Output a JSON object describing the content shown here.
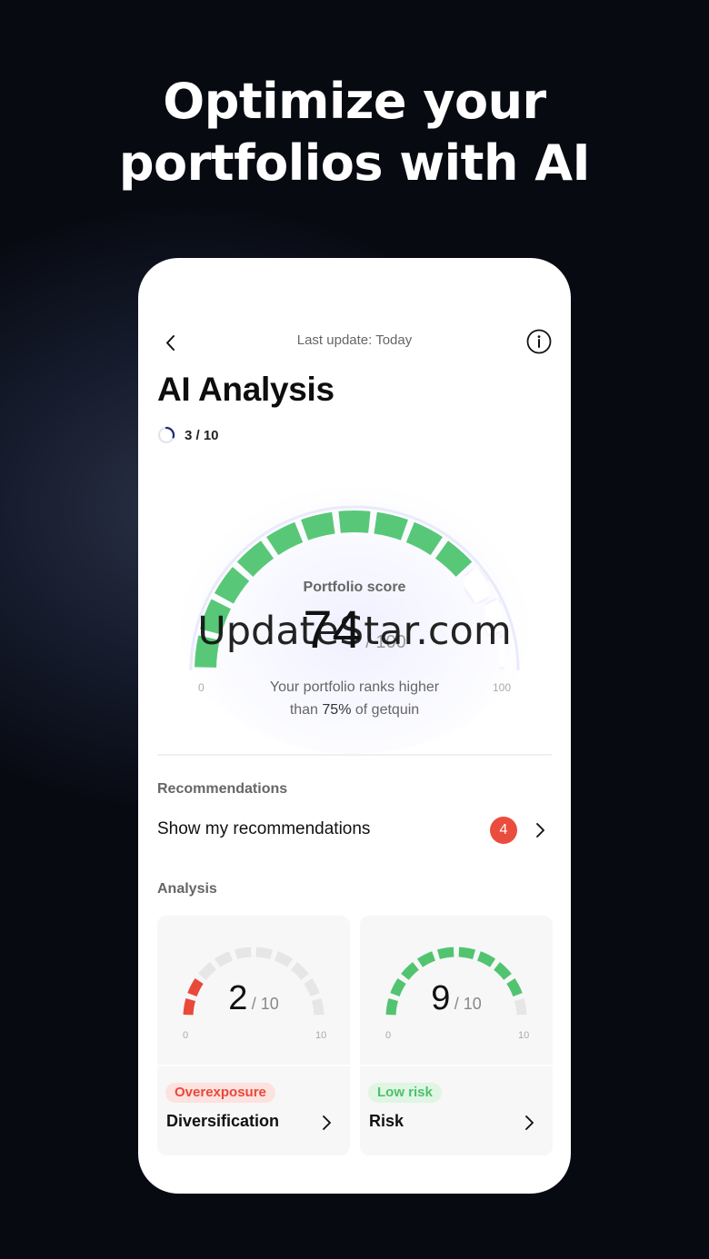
{
  "headline": {
    "line1": "Optimize your",
    "line2": "portfolios with AI"
  },
  "topbar": {
    "last_update": "Last update: Today",
    "back_icon": "chevron-left-icon",
    "info_icon": "info-icon"
  },
  "page_title": "AI Analysis",
  "progress": {
    "label": "3 / 10",
    "value": 3,
    "max": 10
  },
  "portfolio": {
    "label": "Portfolio score",
    "score": "74",
    "score_max": "/ 100",
    "score_value": 74,
    "axis_min": "0",
    "axis_max": "100",
    "rank_line1": "Your portfolio ranks higher",
    "rank_line2_prefix": "than ",
    "rank_percent": "75%",
    "rank_line2_suffix": " of getquin"
  },
  "watermark": "UpdateStar.com",
  "recommendations": {
    "section_label": "Recommendations",
    "row_label": "Show my recommendations",
    "badge": "4"
  },
  "analysis": {
    "section_label": "Analysis",
    "cards": [
      {
        "value": "2",
        "max": "/ 10",
        "score": 2,
        "axis_min": "0",
        "axis_max": "10",
        "pill": "Overexposure",
        "title": "Diversification",
        "color": "#e9493a"
      },
      {
        "value": "9",
        "max": "/ 10",
        "score": 9,
        "axis_min": "0",
        "axis_max": "10",
        "pill": "Low risk",
        "title": "Risk",
        "color": "#52c470"
      }
    ]
  },
  "colors": {
    "gauge_active": "#58c878",
    "gauge_inactive": "#ffffff",
    "mini_inactive": "#e6e6e6",
    "badge": "#ea4d3d"
  }
}
